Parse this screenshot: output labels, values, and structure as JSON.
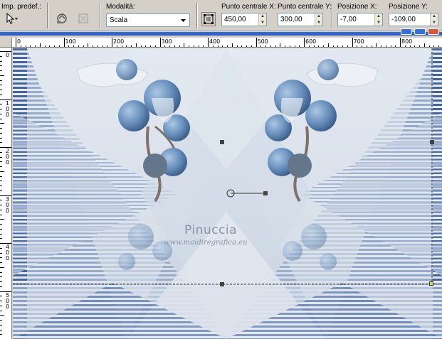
{
  "toolbar": {
    "preset_label": "Imp. predef.:",
    "mode_label": "Modalità:",
    "mode_value": "Scala",
    "center_x_label": "Punto centrale X:",
    "center_x_value": "450,00",
    "center_y_label": "Punto centrale Y:",
    "center_y_value": "300,00",
    "pos_x_label": "Posizione X:",
    "pos_x_value": "-7,00",
    "pos_y_label": "Posizione Y:",
    "pos_y_value": "-109,00"
  },
  "ruler_h": [
    "0",
    "100",
    "200",
    "300",
    "400",
    "500",
    "600",
    "700",
    "800"
  ],
  "ruler_v": [
    "0",
    "100",
    "200",
    "300",
    "400",
    "500"
  ],
  "canvas": {
    "watermark_name": "Pinuccia",
    "watermark_url": "www.maidiregrafica.eu",
    "stripe_color": "#3d5f9c",
    "background_color": "#cfd8e3"
  },
  "icons": [
    "pointer-icon",
    "preset-icon",
    "reset-icon",
    "chevron-down-icon",
    "pick-tool-icon"
  ]
}
